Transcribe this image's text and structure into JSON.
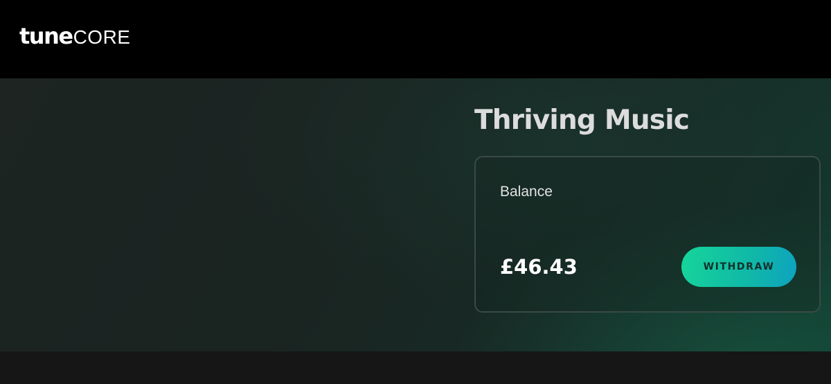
{
  "header": {
    "logo": {
      "bold": "tune",
      "light": "CORE"
    }
  },
  "main": {
    "title": "Thriving Music",
    "balance_card": {
      "label": "Balance",
      "amount": "£46.43",
      "withdraw_label": "WITHDRAW"
    }
  },
  "colors": {
    "header_bg": "#000000",
    "accent_start": "#16d59a",
    "accent_end": "#0ea2c0",
    "title_text": "#dcdcdc"
  }
}
